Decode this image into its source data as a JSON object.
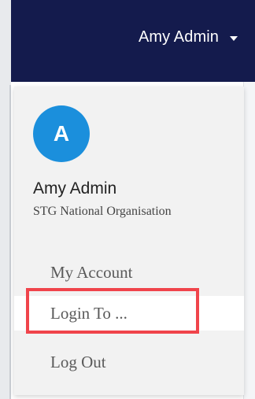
{
  "header": {
    "user_name": "Amy Admin",
    "caret_icon": "caret-down-icon",
    "background_color": "#141b4d"
  },
  "dropdown": {
    "avatar_initial": "A",
    "avatar_color": "#1b8fdc",
    "profile_name": "Amy Admin",
    "organisation": "STG National Organisation",
    "items": [
      {
        "label": "My Account"
      },
      {
        "label": "Login To ..."
      },
      {
        "label": "Log Out"
      }
    ]
  },
  "annotation": {
    "highlight_color": "#f0444b"
  }
}
